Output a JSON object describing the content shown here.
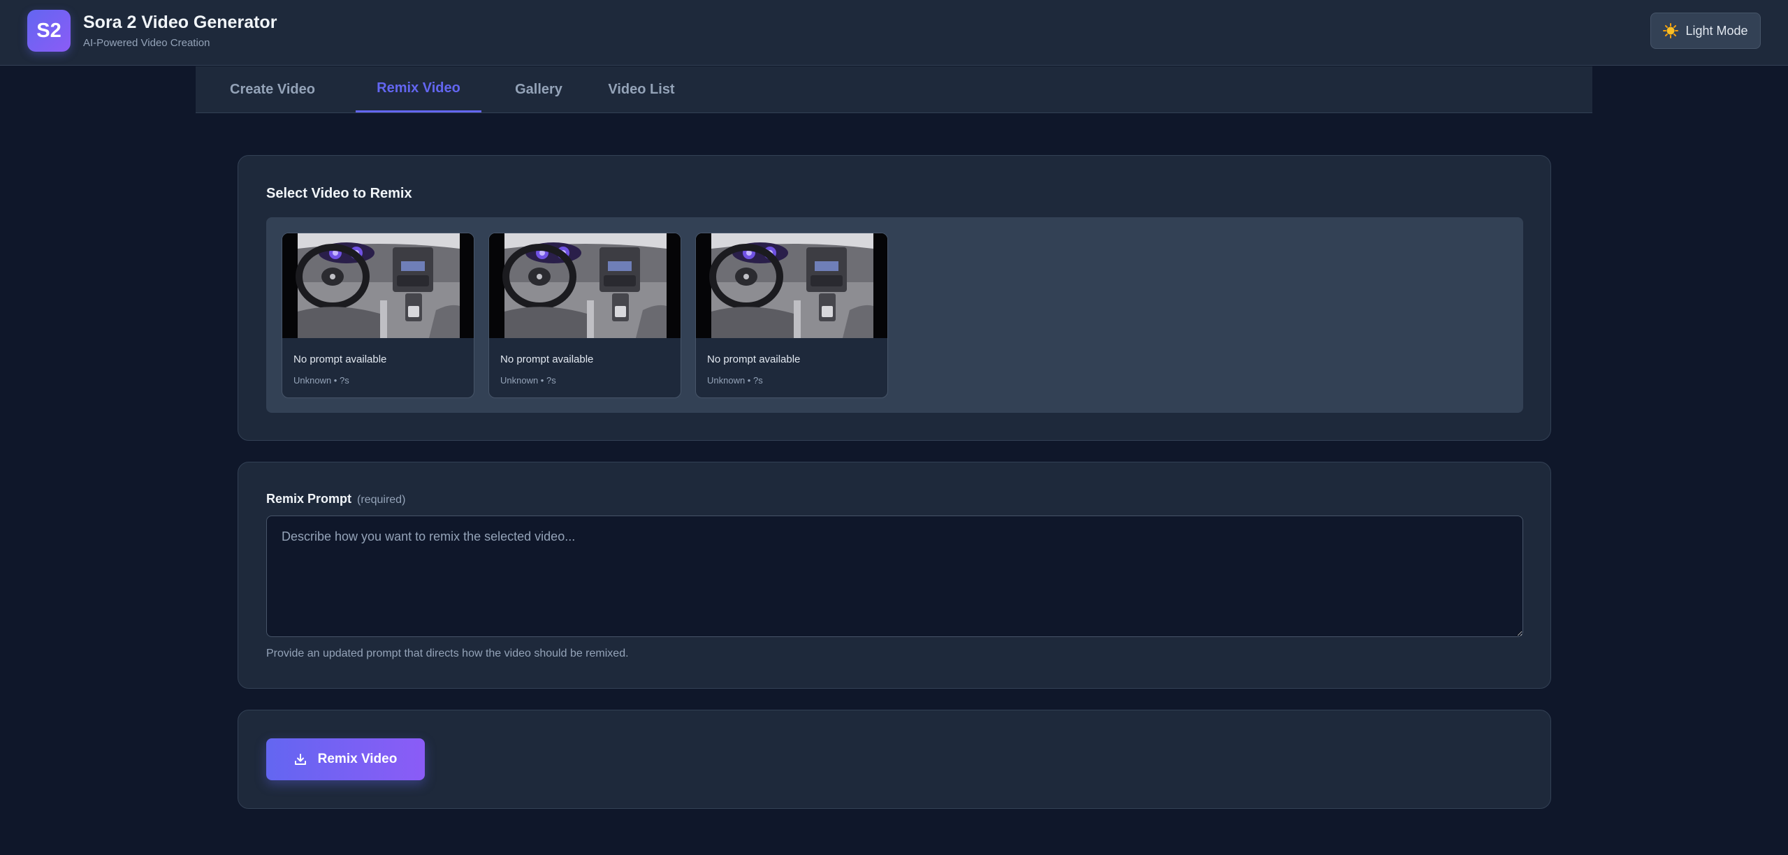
{
  "header": {
    "logo_text": "S2",
    "title": "Sora 2 Video Generator",
    "subtitle": "AI-Powered Video Creation",
    "theme_toggle": {
      "icon": "sun-icon",
      "label": "Light Mode"
    }
  },
  "tabs": [
    {
      "label": "Create Video",
      "active": false
    },
    {
      "label": "Remix Video",
      "active": true
    },
    {
      "label": "Gallery",
      "active": false
    },
    {
      "label": "Video List",
      "active": false
    }
  ],
  "select_section": {
    "title": "Select Video to Remix",
    "videos": [
      {
        "prompt": "No prompt available",
        "meta": "Unknown • ?s",
        "thumbnail": "car-interior-dashboard"
      },
      {
        "prompt": "No prompt available",
        "meta": "Unknown • ?s",
        "thumbnail": "car-interior-dashboard"
      },
      {
        "prompt": "No prompt available",
        "meta": "Unknown • ?s",
        "thumbnail": "car-interior-dashboard"
      }
    ]
  },
  "prompt_section": {
    "label": "Remix Prompt",
    "required_text": "(required)",
    "placeholder": "Describe how you want to remix the selected video...",
    "value": "",
    "help": "Provide an updated prompt that directs how the video should be remixed."
  },
  "action": {
    "button_label": "Remix Video",
    "button_icon": "download-icon"
  },
  "colors": {
    "background": "#0f172a",
    "surface": "#1e293b",
    "accent": "#6366f1",
    "accent_end": "#8b5cf6",
    "text_muted": "#94a3b8"
  }
}
